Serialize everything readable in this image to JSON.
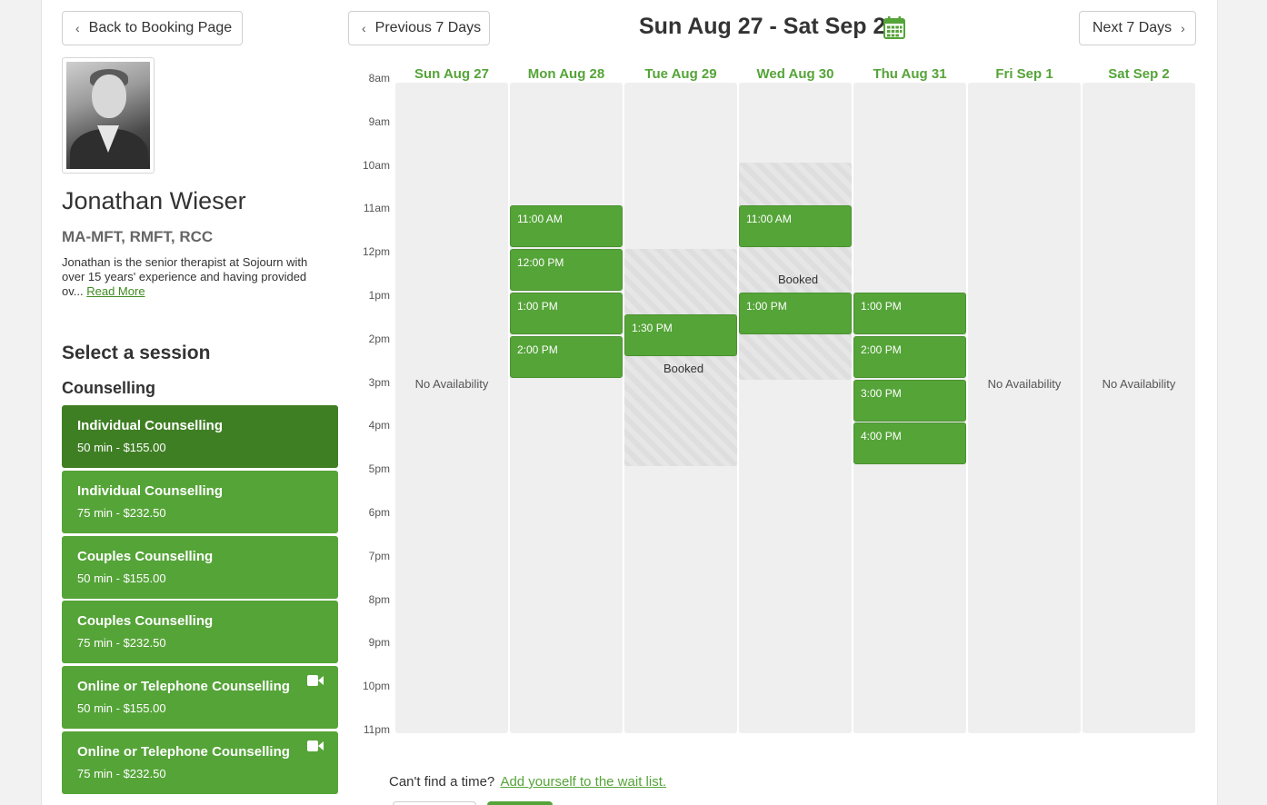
{
  "nav": {
    "back_label": "Back to Booking Page",
    "prev_label": "Previous 7 Days",
    "next_label": "Next 7 Days",
    "week_title": "Sun Aug 27 - Sat Sep 2"
  },
  "provider": {
    "name": "Jonathan Wieser",
    "credentials": "MA-MFT, RMFT, RCC",
    "bio": "Jonathan is the senior therapist at Sojourn with over 15 years' experience and having provided ov...",
    "read_more": "Read More"
  },
  "sessions": {
    "title": "Select a session",
    "category": "Counselling",
    "items": [
      {
        "name": "Individual Counselling",
        "detail": "50 min - $155.00",
        "video": false,
        "selected": true
      },
      {
        "name": "Individual Counselling",
        "detail": "75 min - $232.50",
        "video": false,
        "selected": false
      },
      {
        "name": "Couples Counselling",
        "detail": "50 min - $155.00",
        "video": false,
        "selected": false
      },
      {
        "name": "Couples Counselling",
        "detail": "75 min - $232.50",
        "video": false,
        "selected": false
      },
      {
        "name": "Online or Telephone Counselling",
        "detail": "50 min - $155.00",
        "video": true,
        "selected": false
      },
      {
        "name": "Online or Telephone Counselling",
        "detail": "75 min - $232.50",
        "video": true,
        "selected": false
      }
    ]
  },
  "calendar": {
    "hours": [
      "8am",
      "9am",
      "10am",
      "11am",
      "12pm",
      "1pm",
      "2pm",
      "3pm",
      "4pm",
      "5pm",
      "6pm",
      "7pm",
      "8pm",
      "9pm",
      "10pm",
      "11pm"
    ],
    "no_availability": "No Availability",
    "booked_label": "Booked",
    "days": [
      {
        "label": "Sun Aug 27",
        "available": false,
        "slots": [],
        "booked": []
      },
      {
        "label": "Mon Aug 28",
        "available": true,
        "slots": [
          {
            "label": "11:00 AM",
            "start": 11
          },
          {
            "label": "12:00 PM",
            "start": 12
          },
          {
            "label": "1:00 PM",
            "start": 13
          },
          {
            "label": "2:00 PM",
            "start": 14
          }
        ],
        "booked": []
      },
      {
        "label": "Tue Aug 29",
        "available": true,
        "slots": [
          {
            "label": "1:30 PM",
            "start": 13.5
          }
        ],
        "booked": [
          {
            "start": 12,
            "end": 17,
            "label_at": 14.6
          }
        ]
      },
      {
        "label": "Wed Aug 30",
        "available": true,
        "slots": [
          {
            "label": "11:00 AM",
            "start": 11
          },
          {
            "label": "1:00 PM",
            "start": 13
          }
        ],
        "booked": [
          {
            "start": 10,
            "end": 15,
            "label_at": 12.55
          }
        ]
      },
      {
        "label": "Thu Aug 31",
        "available": true,
        "slots": [
          {
            "label": "1:00 PM",
            "start": 13
          },
          {
            "label": "2:00 PM",
            "start": 14
          },
          {
            "label": "3:00 PM",
            "start": 15
          },
          {
            "label": "4:00 PM",
            "start": 16
          }
        ],
        "booked": []
      },
      {
        "label": "Fri Sep 1",
        "available": false,
        "slots": [],
        "booked": []
      },
      {
        "label": "Sat Sep 2",
        "available": false,
        "slots": [],
        "booked": []
      }
    ]
  },
  "footer": {
    "question": "Can't find a time?",
    "waitlist_link": "Add yourself to the wait list."
  },
  "colors": {
    "accent": "#55a438",
    "accent_dark": "#3f7f24"
  }
}
